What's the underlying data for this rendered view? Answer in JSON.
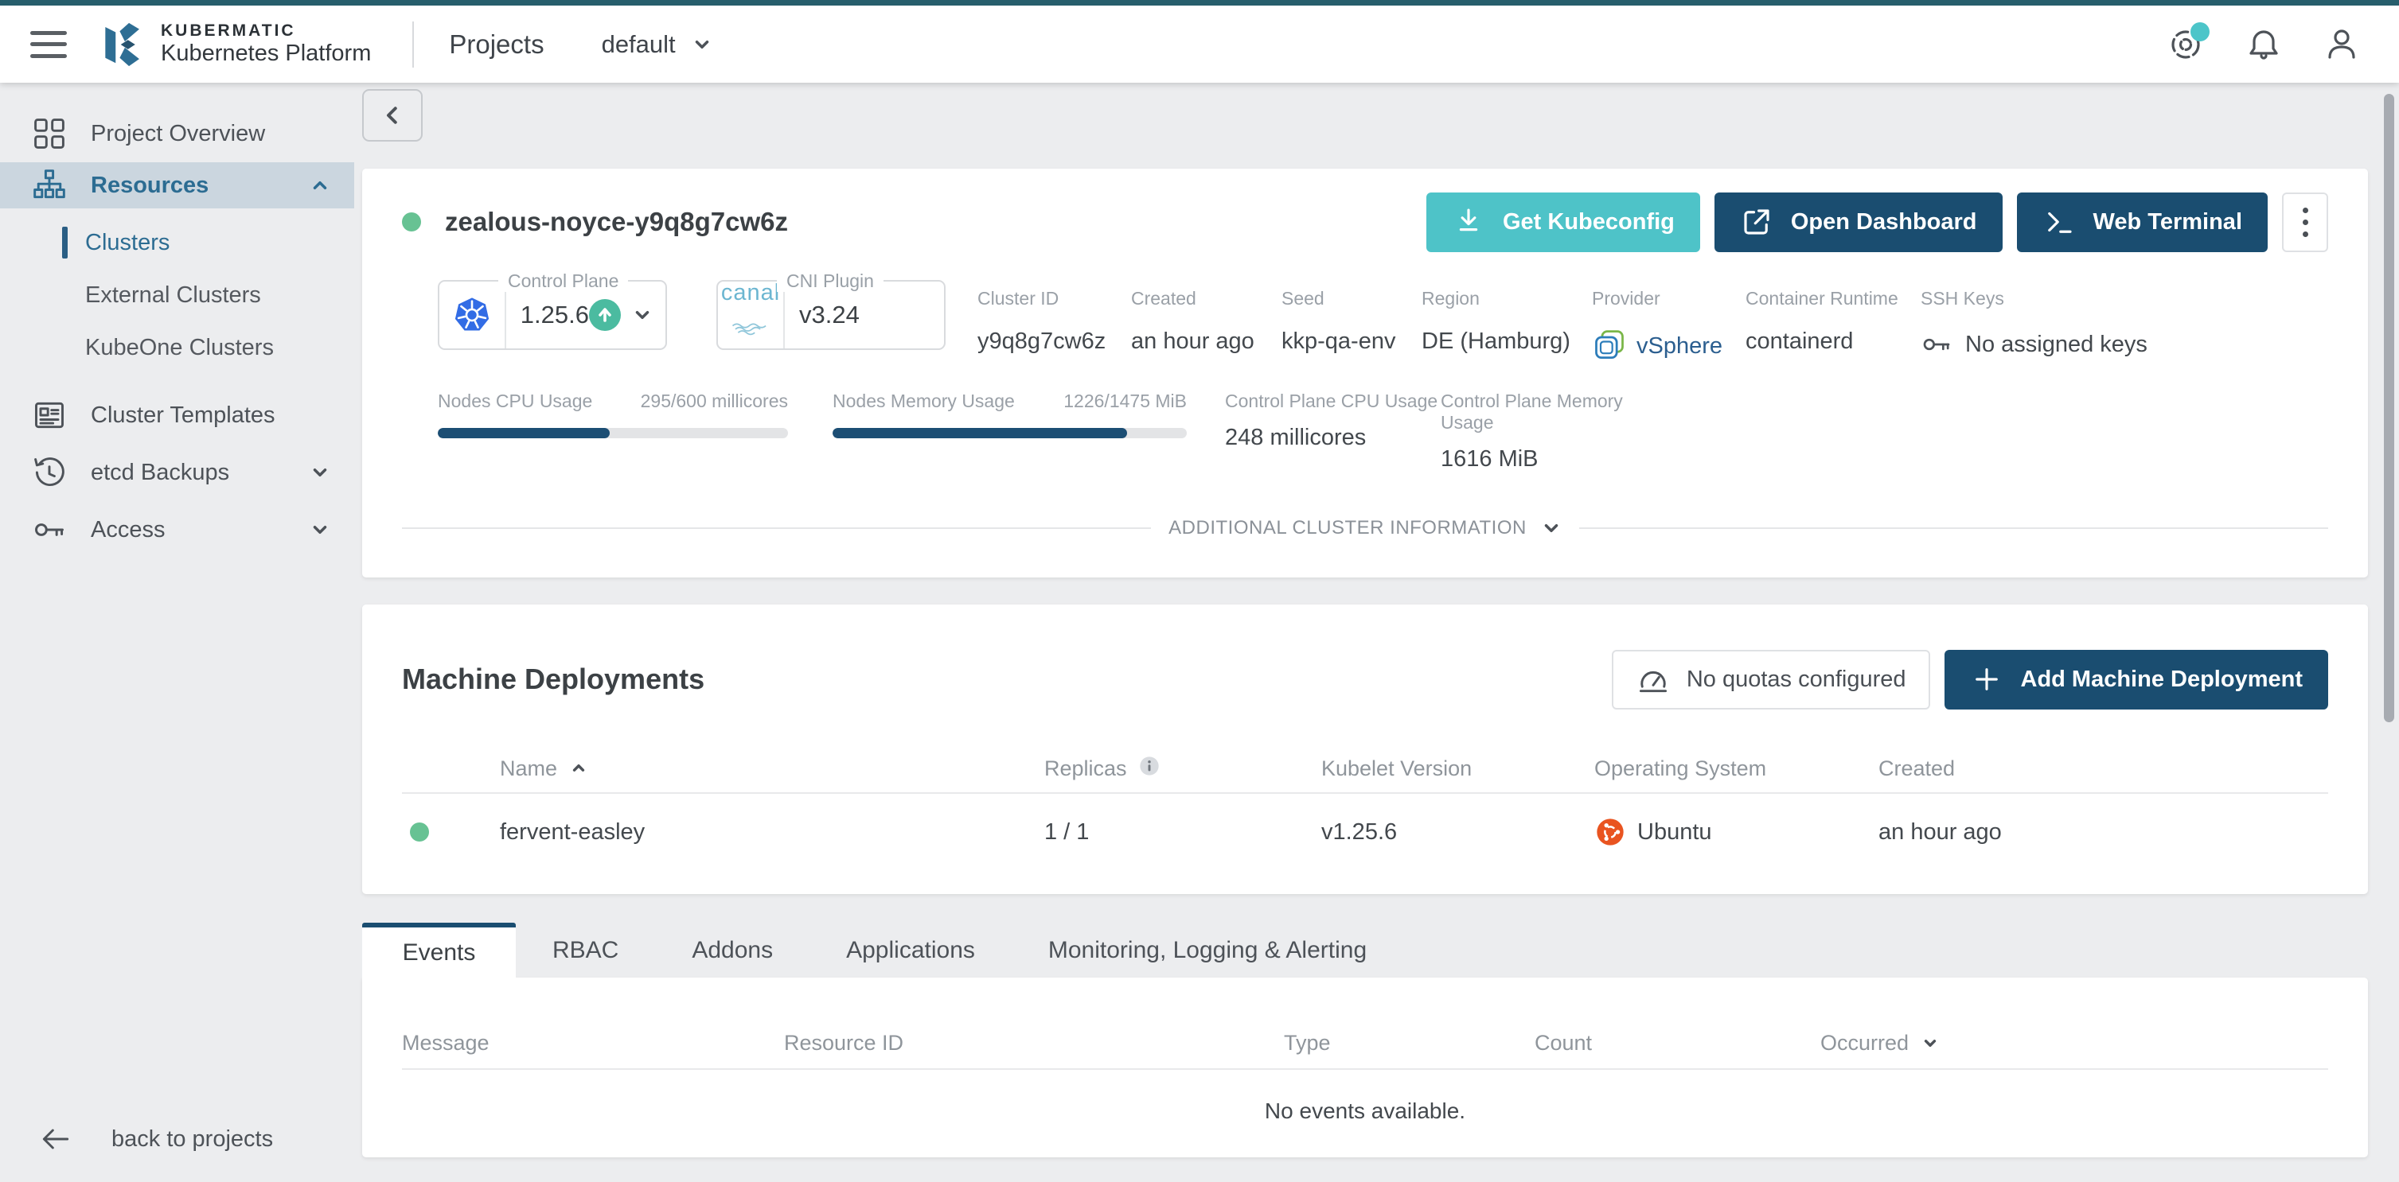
{
  "topbar": {
    "brand_line1": "KUBERMATIC",
    "brand_line2": "Kubernetes Platform",
    "nav_title": "Projects",
    "project_selector": "default"
  },
  "sidebar": {
    "items": [
      {
        "label": "Project Overview"
      },
      {
        "label": "Resources"
      },
      {
        "label": "Clusters"
      },
      {
        "label": "External Clusters"
      },
      {
        "label": "KubeOne Clusters"
      },
      {
        "label": "Cluster Templates"
      },
      {
        "label": "etcd Backups"
      },
      {
        "label": "Access"
      }
    ],
    "back_link": "back to projects"
  },
  "cluster": {
    "name": "zealous-noyce-y9q8g7cw6z",
    "actions": {
      "kubeconfig": "Get Kubeconfig",
      "dashboard": "Open Dashboard",
      "terminal": "Web Terminal"
    },
    "control_plane": {
      "label": "Control Plane",
      "version": "1.25.6"
    },
    "cni": {
      "label": "CNI Plugin",
      "logo": "canal",
      "version": "v3.24"
    },
    "info": {
      "cluster_id": {
        "label": "Cluster ID",
        "value": "y9q8g7cw6z"
      },
      "created": {
        "label": "Created",
        "value": "an hour ago"
      },
      "seed": {
        "label": "Seed",
        "value": "kkp-qa-env"
      },
      "region": {
        "label": "Region",
        "value": "DE (Hamburg)"
      },
      "provider": {
        "label": "Provider",
        "value": "vSphere"
      },
      "runtime": {
        "label": "Container Runtime",
        "value": "containerd"
      },
      "ssh_keys": {
        "label": "SSH Keys",
        "value": "No assigned keys"
      }
    },
    "usage": {
      "nodes_cpu": {
        "label": "Nodes CPU Usage",
        "value": "295/600 millicores",
        "percent": 49.2
      },
      "nodes_memory": {
        "label": "Nodes Memory Usage",
        "value": "1226/1475 MiB",
        "percent": 83.1
      },
      "cp_cpu": {
        "label": "Control Plane CPU Usage",
        "value": "248 millicores"
      },
      "cp_memory": {
        "label": "Control Plane Memory Usage",
        "value": "1616 MiB"
      }
    },
    "additional_info_label": "ADDITIONAL CLUSTER INFORMATION"
  },
  "machine_deployments": {
    "title": "Machine Deployments",
    "quota_button": "No quotas configured",
    "add_button": "Add Machine Deployment",
    "columns": {
      "name": "Name",
      "replicas": "Replicas",
      "kubelet": "Kubelet Version",
      "os": "Operating System",
      "created": "Created"
    },
    "rows": [
      {
        "name": "fervent-easley",
        "replicas": "1 / 1",
        "kubelet": "v1.25.6",
        "os": "Ubuntu",
        "created": "an hour ago"
      }
    ]
  },
  "tabs": [
    "Events",
    "RBAC",
    "Addons",
    "Applications",
    "Monitoring, Logging & Alerting"
  ],
  "events": {
    "columns": {
      "message": "Message",
      "resource_id": "Resource ID",
      "type": "Type",
      "count": "Count",
      "occurred": "Occurred"
    },
    "empty_message": "No events available."
  },
  "colors": {
    "accent_teal": "#4EC3C8",
    "navy": "#1A4D70",
    "status_green": "#67C293",
    "kubernetes_blue": "#326CE5",
    "ubuntu_orange": "#E95420",
    "notification_badge": "#4CC5C9",
    "topbar_accent": "#275E6C"
  }
}
